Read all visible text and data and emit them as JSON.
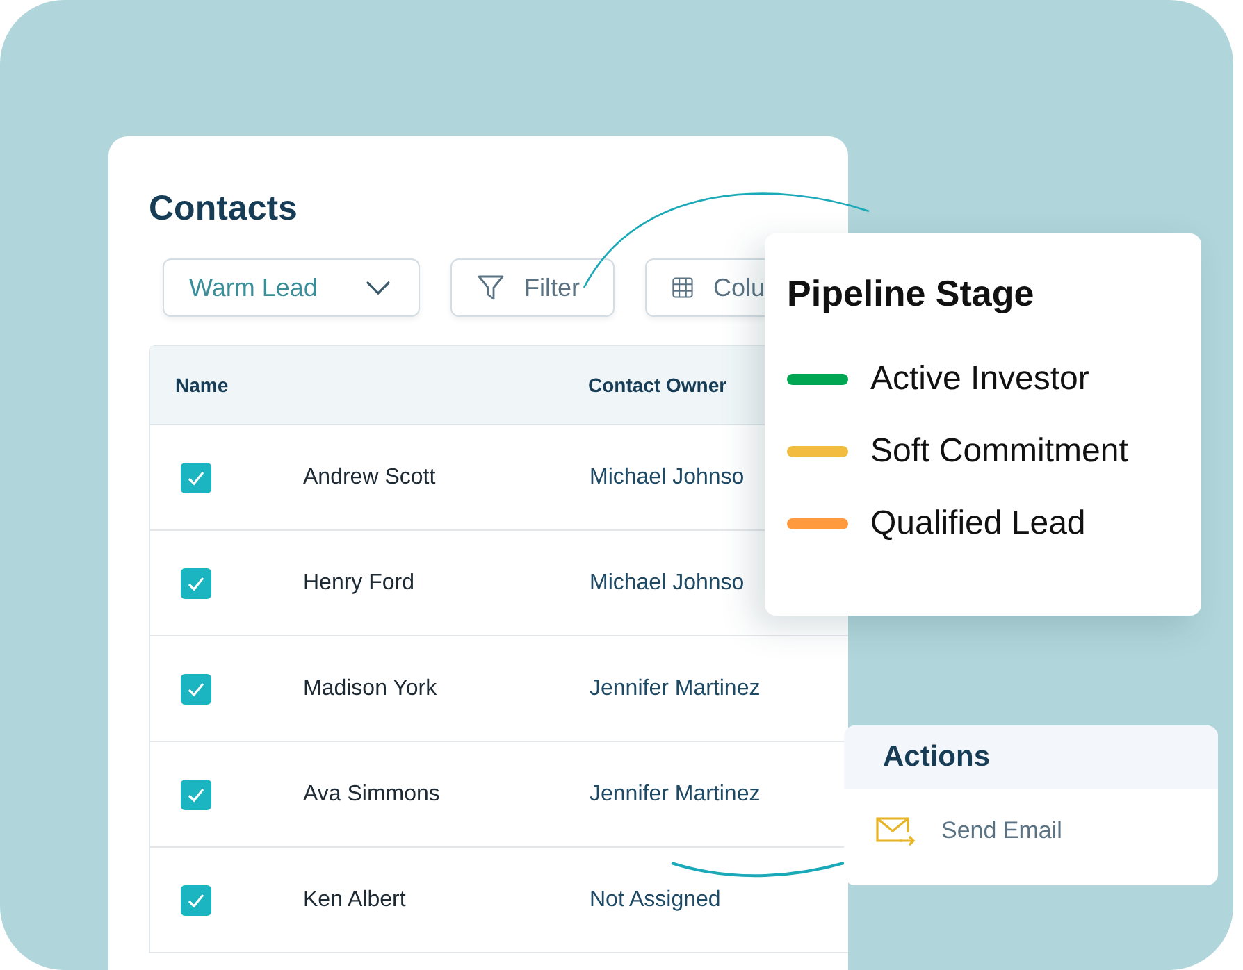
{
  "contacts": {
    "title": "Contacts",
    "stage_dropdown": {
      "value": "Warm Lead"
    },
    "filter_button": {
      "label": "Filter"
    },
    "columns_button": {
      "label": "Colu"
    },
    "table": {
      "columns": [
        "Name",
        "Contact Owner"
      ],
      "rows": [
        {
          "checked": true,
          "name": "Andrew Scott",
          "owner": "Michael Johnso"
        },
        {
          "checked": true,
          "name": "Henry Ford",
          "owner": "Michael Johnso"
        },
        {
          "checked": true,
          "name": "Madison York",
          "owner": "Jennifer Martinez"
        },
        {
          "checked": true,
          "name": "Ava Simmons",
          "owner": "Jennifer Martinez"
        },
        {
          "checked": true,
          "name": "Ken Albert",
          "owner": "Not Assigned"
        }
      ]
    }
  },
  "pipeline_stage": {
    "title": "Pipeline Stage",
    "items": [
      {
        "label": "Active Investor",
        "color": "#00a651"
      },
      {
        "label": "Soft Commitment",
        "color": "#f2bc41"
      },
      {
        "label": "Qualified Lead",
        "color": "#ff9a3e"
      }
    ]
  },
  "actions": {
    "title": "Actions",
    "items": [
      {
        "label": "Send Email"
      }
    ]
  }
}
